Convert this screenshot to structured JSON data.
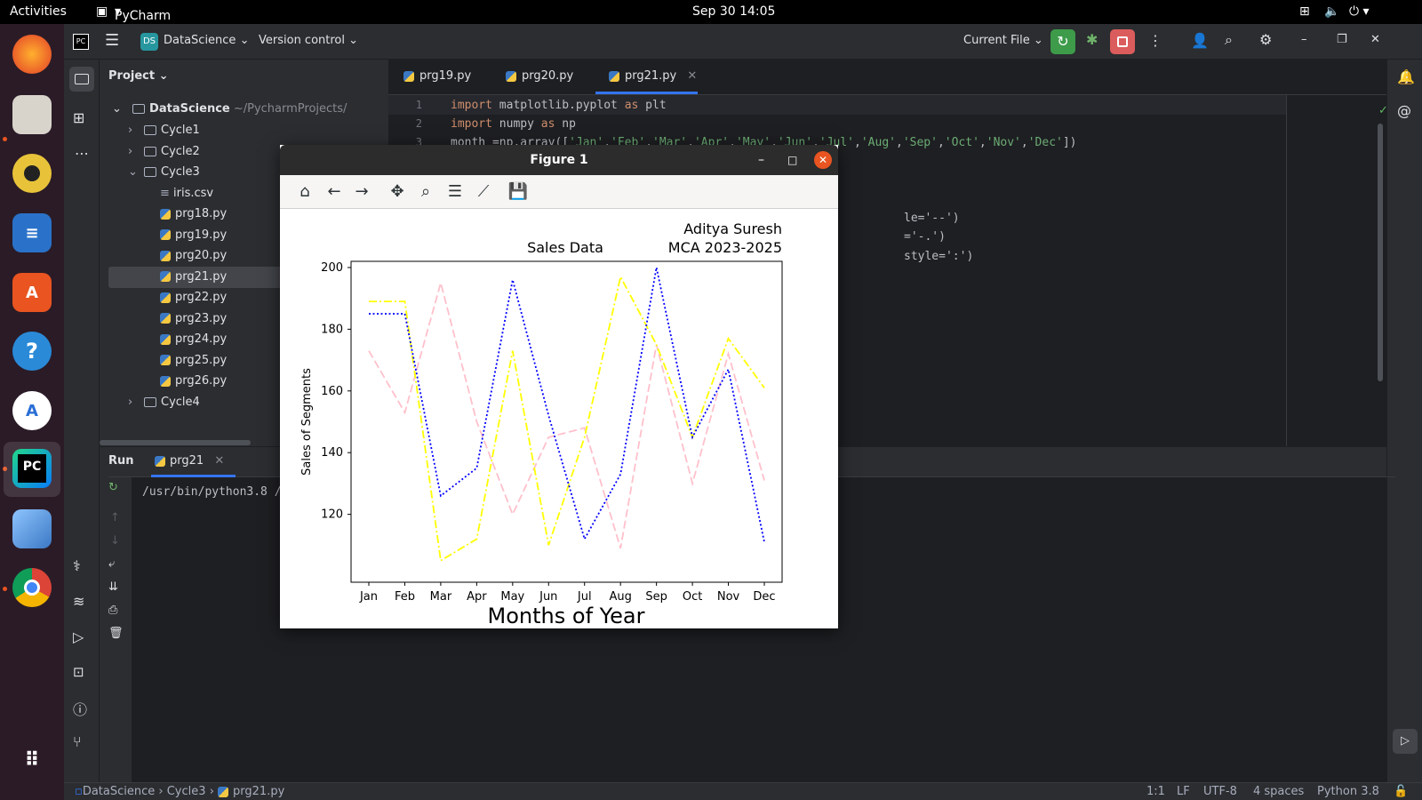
{
  "topbar": {
    "activities": "Activities",
    "app_name": "PyCharm Community Edition",
    "datetime": "Sep 30  14:05"
  },
  "header": {
    "project_badge": "DS",
    "project_name": "DataScience",
    "vcs": "Version control",
    "run_config": "Current File"
  },
  "project_panel": {
    "title": "Project",
    "root": "DataScience",
    "root_path": "~/PycharmProjects/",
    "items": [
      {
        "label": "Cycle1",
        "type": "folder",
        "depth": 1,
        "expanded": false
      },
      {
        "label": "Cycle2",
        "type": "folder",
        "depth": 1,
        "expanded": false
      },
      {
        "label": "Cycle3",
        "type": "folder",
        "depth": 1,
        "expanded": true
      },
      {
        "label": "iris.csv",
        "type": "csv",
        "depth": 2
      },
      {
        "label": "prg18.py",
        "type": "py",
        "depth": 2
      },
      {
        "label": "prg19.py",
        "type": "py",
        "depth": 2
      },
      {
        "label": "prg20.py",
        "type": "py",
        "depth": 2
      },
      {
        "label": "prg21.py",
        "type": "py",
        "depth": 2,
        "selected": true
      },
      {
        "label": "prg22.py",
        "type": "py",
        "depth": 2
      },
      {
        "label": "prg23.py",
        "type": "py",
        "depth": 2
      },
      {
        "label": "prg24.py",
        "type": "py",
        "depth": 2
      },
      {
        "label": "prg25.py",
        "type": "py",
        "depth": 2
      },
      {
        "label": "prg26.py",
        "type": "py",
        "depth": 2
      },
      {
        "label": "Cycle4",
        "type": "folder",
        "depth": 1,
        "expanded": false
      }
    ]
  },
  "editor": {
    "tabs": [
      "prg19.py",
      "prg20.py",
      "prg21.py"
    ],
    "active_tab": "prg21.py",
    "line_numbers": [
      "1",
      "2",
      "3"
    ],
    "visible_code_fragments": [
      "le='--')",
      "='-.')",
      "style=':')"
    ]
  },
  "run": {
    "title": "Run",
    "tab": "prg21",
    "output": "/usr/bin/python3.8 /"
  },
  "statusbar": {
    "crumbs": [
      "DataScience",
      "Cycle3",
      "prg21.py"
    ],
    "position": "1:1",
    "line_sep": "LF",
    "encoding": "UTF-8",
    "indent": "4 spaces",
    "interpreter": "Python 3.8"
  },
  "figure": {
    "window_title": "Figure 1"
  },
  "chart_data": {
    "type": "line",
    "title": "Sales Data",
    "title_right": [
      "Aditya Suresh",
      "MCA 2023-2025"
    ],
    "xlabel": "Months of Year",
    "ylabel": "Sales of Segments",
    "categories": [
      "Jan",
      "Feb",
      "Mar",
      "Apr",
      "May",
      "Jun",
      "Jul",
      "Aug",
      "Sep",
      "Oct",
      "Nov",
      "Dec"
    ],
    "ylim": [
      98,
      202
    ],
    "yticks": [
      120,
      140,
      160,
      180,
      200
    ],
    "grid": false,
    "series": [
      {
        "color": "#ffc0cb",
        "style": "dashed",
        "values": [
          173,
          153,
          195,
          150,
          120,
          145,
          148,
          109,
          175,
          130,
          172,
          131
        ]
      },
      {
        "color": "#ffff00",
        "style": "dashdot",
        "values": [
          189,
          189,
          105,
          112,
          173,
          110,
          145,
          197,
          175,
          145,
          177,
          161
        ]
      },
      {
        "color": "#0000ff",
        "style": "dotted",
        "values": [
          185,
          185,
          126,
          135,
          196,
          152,
          112,
          133,
          200,
          145,
          167,
          111
        ]
      }
    ]
  }
}
